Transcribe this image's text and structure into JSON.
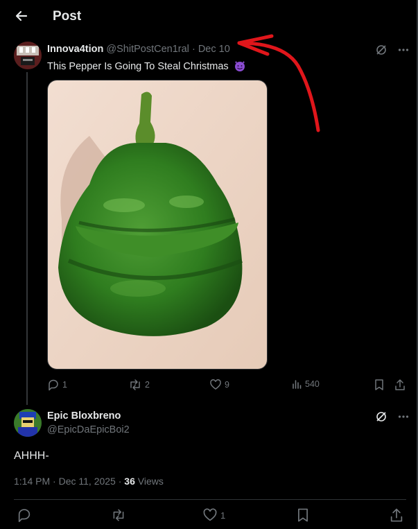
{
  "header": {
    "title": "Post",
    "back_icon": "arrow-left-icon"
  },
  "post": {
    "author_name": "Innova4tion",
    "author_handle": "@ShitPostCen1ral",
    "separator": "·",
    "date": "Dec 10",
    "text": "This Pepper Is Going To Steal Christmas",
    "emoji": "smiling-devil-emoji",
    "media_description": "green-pepper-photo",
    "stats": {
      "replies": "1",
      "reposts": "2",
      "likes": "9",
      "views": "540"
    }
  },
  "reply": {
    "author_name": "Epic Bloxbreno",
    "author_handle": "@EpicDaEpicBoi2",
    "text": "AHHH-",
    "time": "1:14 PM",
    "date": "Dec 11, 2025",
    "views_count": "36",
    "views_label": "Views",
    "stats": {
      "likes": "1"
    }
  },
  "colors": {
    "background": "#000000",
    "muted": "#71767b",
    "text": "#e7e9ea",
    "annotation": "#e0161b",
    "pepper": "#2f7d1f"
  }
}
